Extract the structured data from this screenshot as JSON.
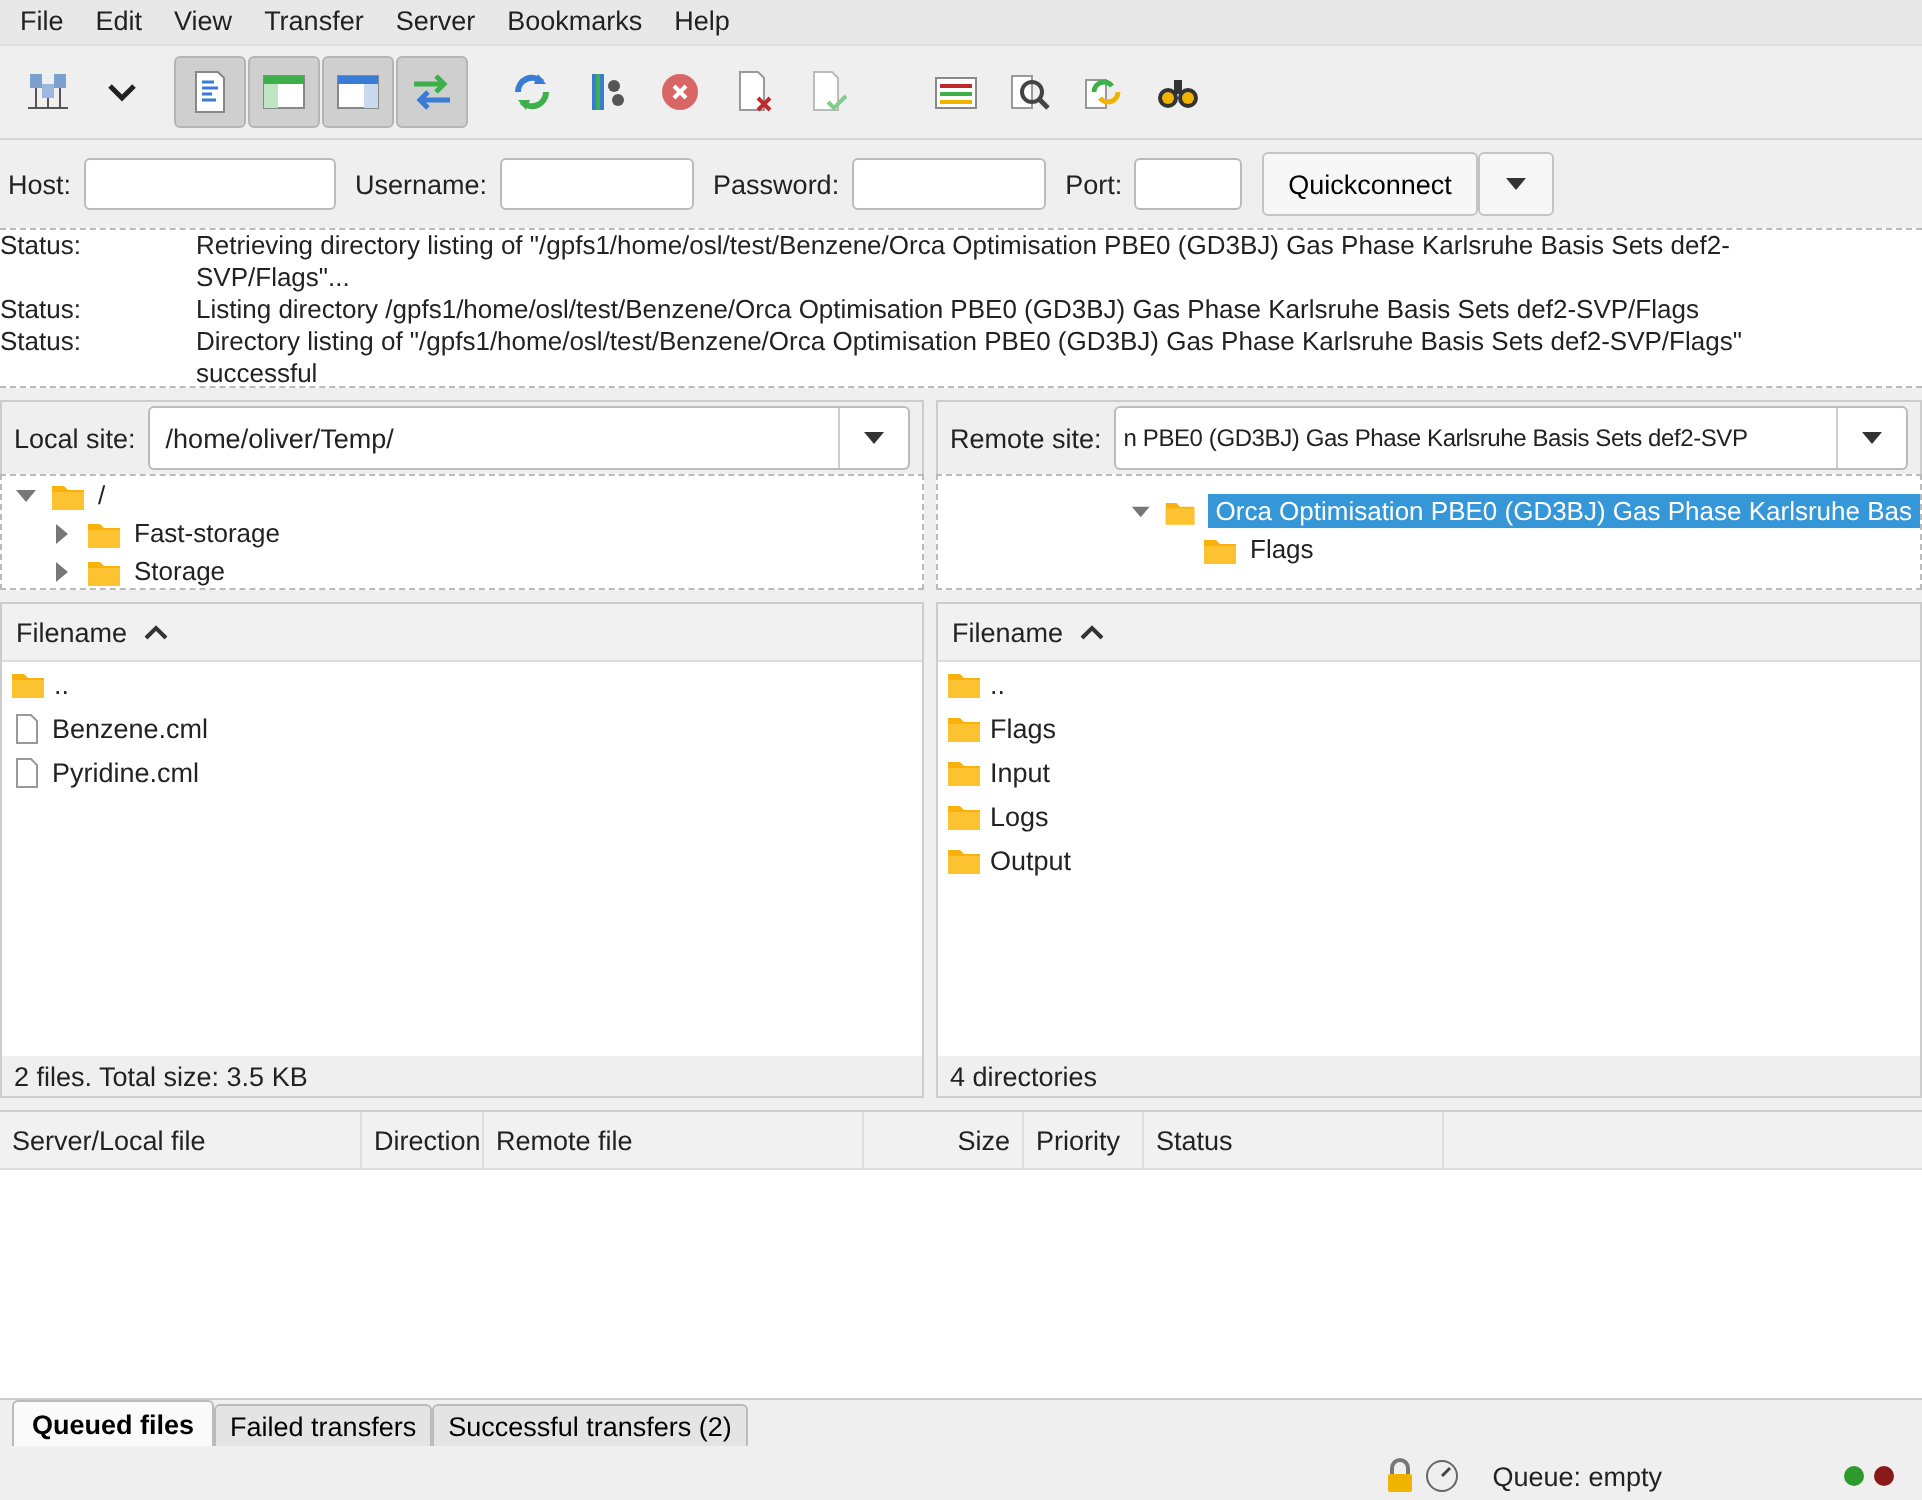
{
  "menu": [
    "File",
    "Edit",
    "View",
    "Transfer",
    "Server",
    "Bookmarks",
    "Help"
  ],
  "toolbar": [
    {
      "kind": "site-manager",
      "pressed": false
    },
    {
      "kind": "dropdown",
      "pressed": false
    },
    {
      "kind": "message-log",
      "pressed": true
    },
    {
      "kind": "local-tree",
      "pressed": true
    },
    {
      "kind": "remote-tree",
      "pressed": true
    },
    {
      "kind": "transfer-queue",
      "pressed": true
    },
    {
      "kind": "refresh",
      "pressed": false
    },
    {
      "kind": "filter",
      "pressed": false
    },
    {
      "kind": "cancel",
      "pressed": false
    },
    {
      "kind": "disconnect",
      "pressed": false
    },
    {
      "kind": "reconnect",
      "pressed": false
    },
    {
      "kind": "compare",
      "pressed": false
    },
    {
      "kind": "search",
      "pressed": false
    },
    {
      "kind": "sync",
      "pressed": false
    },
    {
      "kind": "find",
      "pressed": false
    }
  ],
  "quickconnect": {
    "fields": [
      {
        "label": "Host:"
      },
      {
        "label": "Username:"
      },
      {
        "label": "Password:"
      },
      {
        "label": "Port:"
      }
    ],
    "button": "Quickconnect"
  },
  "log": [
    {
      "label": "Status:",
      "message": "Retrieving directory listing of \"/gpfs1/home/osl/test/Benzene/Orca Optimisation PBE0 (GD3BJ) Gas Phase Karlsruhe Basis Sets def2-SVP/Flags\"..."
    },
    {
      "label": "Status:",
      "message": "Listing directory /gpfs1/home/osl/test/Benzene/Orca Optimisation PBE0 (GD3BJ) Gas Phase Karlsruhe Basis Sets def2-SVP/Flags"
    },
    {
      "label": "Status:",
      "message": "Directory listing of \"/gpfs1/home/osl/test/Benzene/Orca Optimisation PBE0 (GD3BJ) Gas Phase Karlsruhe Basis Sets def2-SVP/Flags\" successful"
    }
  ],
  "local": {
    "label": "Local site:",
    "path": "/home/oliver/Temp/",
    "tree": [
      {
        "name": "/",
        "expanded": true,
        "selected": false,
        "children": [
          {
            "name": "Fast-storage",
            "expanded": false,
            "selected": false
          },
          {
            "name": "Storage",
            "expanded": false,
            "selected": false
          }
        ]
      }
    ],
    "column": "Filename",
    "files": [
      {
        "name": "..",
        "kind": "folder"
      },
      {
        "name": "Benzene.cml",
        "kind": "file"
      },
      {
        "name": "Pyridine.cml",
        "kind": "file"
      }
    ],
    "status": "2 files. Total size: 3.5 KB"
  },
  "remote": {
    "label": "Remote site:",
    "path": "n PBE0 (GD3BJ) Gas Phase Karlsruhe Basis Sets def2-SVP",
    "tree": [
      {
        "name": "Orca Optimisation PBE0 (GD3BJ) Gas Phase Karlsruhe Bas",
        "expanded": true,
        "selected": true,
        "children": [
          {
            "name": "Flags",
            "selected": false
          }
        ]
      }
    ],
    "column": "Filename",
    "files": [
      {
        "name": "..",
        "kind": "folder"
      },
      {
        "name": "Flags",
        "kind": "folder"
      },
      {
        "name": "Input",
        "kind": "folder"
      },
      {
        "name": "Logs",
        "kind": "folder"
      },
      {
        "name": "Output",
        "kind": "folder"
      }
    ],
    "status": "4 directories"
  },
  "queue": {
    "columns": [
      "Server/Local file",
      "Direction",
      "Remote file",
      "Size",
      "Priority",
      "Status"
    ]
  },
  "tabs": [
    {
      "label": "Queued files",
      "selected": true
    },
    {
      "label": "Failed transfers",
      "selected": false
    },
    {
      "label": "Successful transfers (2)",
      "selected": false
    }
  ],
  "status_bar": {
    "queue": "Queue: empty"
  }
}
